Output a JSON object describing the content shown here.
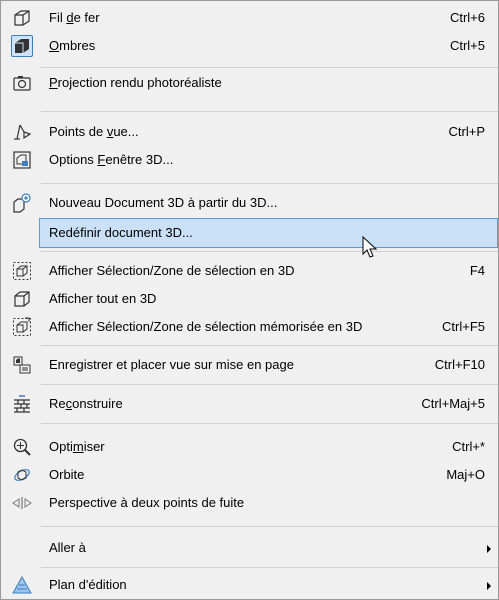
{
  "menu": {
    "items": [
      {
        "pre": "Fil ",
        "acc": "d",
        "post": "e fer",
        "shortcut": "Ctrl+6",
        "icon": "wireframe-icon"
      },
      {
        "pre": "",
        "acc": "O",
        "post": "mbres",
        "shortcut": "Ctrl+5",
        "icon": "shaded-box-icon"
      },
      {
        "pre": "",
        "acc": "P",
        "post": "rojection rendu photoréaliste",
        "shortcut": "",
        "icon": "camera-icon"
      },
      {
        "pre": "Points de ",
        "acc": "v",
        "post": "ue...",
        "shortcut": "Ctrl+P",
        "icon": "viewpoint-icon"
      },
      {
        "pre": "Options ",
        "acc": "F",
        "post": "enêtre 3D...",
        "shortcut": "",
        "icon": "window-options-icon"
      },
      {
        "pre": "Nouveau Document 3D à partir du 3D...",
        "acc": "",
        "post": "",
        "shortcut": "",
        "icon": "new-document-icon"
      },
      {
        "pre": "Redéfinir document 3D...",
        "acc": "",
        "post": "",
        "shortcut": "",
        "icon": ""
      },
      {
        "pre": "Afficher Sélection/Zone de sélection en 3D",
        "acc": "",
        "post": "",
        "shortcut": "F4",
        "icon": "selection-box-icon"
      },
      {
        "pre": "Afficher tout en 3D",
        "acc": "",
        "post": "",
        "shortcut": "",
        "icon": "cube-icon"
      },
      {
        "pre": "Afficher Sélection/Zone de sélection mémorisée en 3D",
        "acc": "",
        "post": "",
        "shortcut": "Ctrl+F5",
        "icon": "stored-selection-icon"
      },
      {
        "pre": "Enregistrer et placer vue sur mise en page",
        "acc": "",
        "post": "",
        "shortcut": "Ctrl+F10",
        "icon": "save-place-icon"
      },
      {
        "pre": "Re",
        "acc": "c",
        "post": "onstruire",
        "shortcut": "Ctrl+Maj+5",
        "icon": "rebuild-icon"
      },
      {
        "pre": "Opti",
        "acc": "m",
        "post": "iser",
        "shortcut": "Ctrl+*",
        "icon": "zoom-icon"
      },
      {
        "pre": "Orbite",
        "acc": "",
        "post": "",
        "shortcut": "Maj+O",
        "icon": "orbit-icon"
      },
      {
        "pre": "Perspective à deux points de fuite",
        "acc": "",
        "post": "",
        "shortcut": "",
        "icon": "two-point-perspective-icon"
      },
      {
        "pre": "Aller à",
        "acc": "",
        "post": "",
        "shortcut": "",
        "icon": ""
      },
      {
        "pre": "Plan d'édition",
        "acc": "",
        "post": "",
        "shortcut": "",
        "icon": "edit-plane-icon"
      }
    ]
  },
  "colors": {
    "highlight": "#c9e0f7",
    "highlight_border": "#5c9be0",
    "separator": "#d0d0d0"
  }
}
